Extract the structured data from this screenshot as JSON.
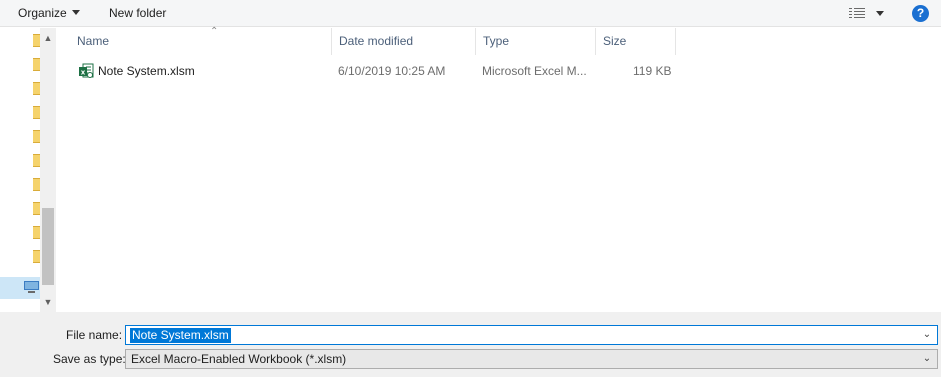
{
  "toolbar": {
    "organize_label": "Organize",
    "new_folder_label": "New folder",
    "help_label": "?"
  },
  "columns": {
    "name": "Name",
    "date_modified": "Date modified",
    "type": "Type",
    "size": "Size"
  },
  "files": [
    {
      "name": "Note System.xlsm",
      "date_modified": "6/10/2019 10:25 AM",
      "type": "Microsoft Excel M...",
      "size": "119 KB",
      "icon": "excel-macro-icon"
    }
  ],
  "bottom": {
    "file_name_label": "File name:",
    "file_name_value": "Note System.xlsm",
    "save_type_label": "Save as type:",
    "save_type_value": "Excel Macro-Enabled Workbook (*.xlsm)"
  },
  "colors": {
    "selection": "#0078d7",
    "help": "#1a6fd1",
    "folder": "#f5d36c",
    "excel": "#1d7044"
  }
}
